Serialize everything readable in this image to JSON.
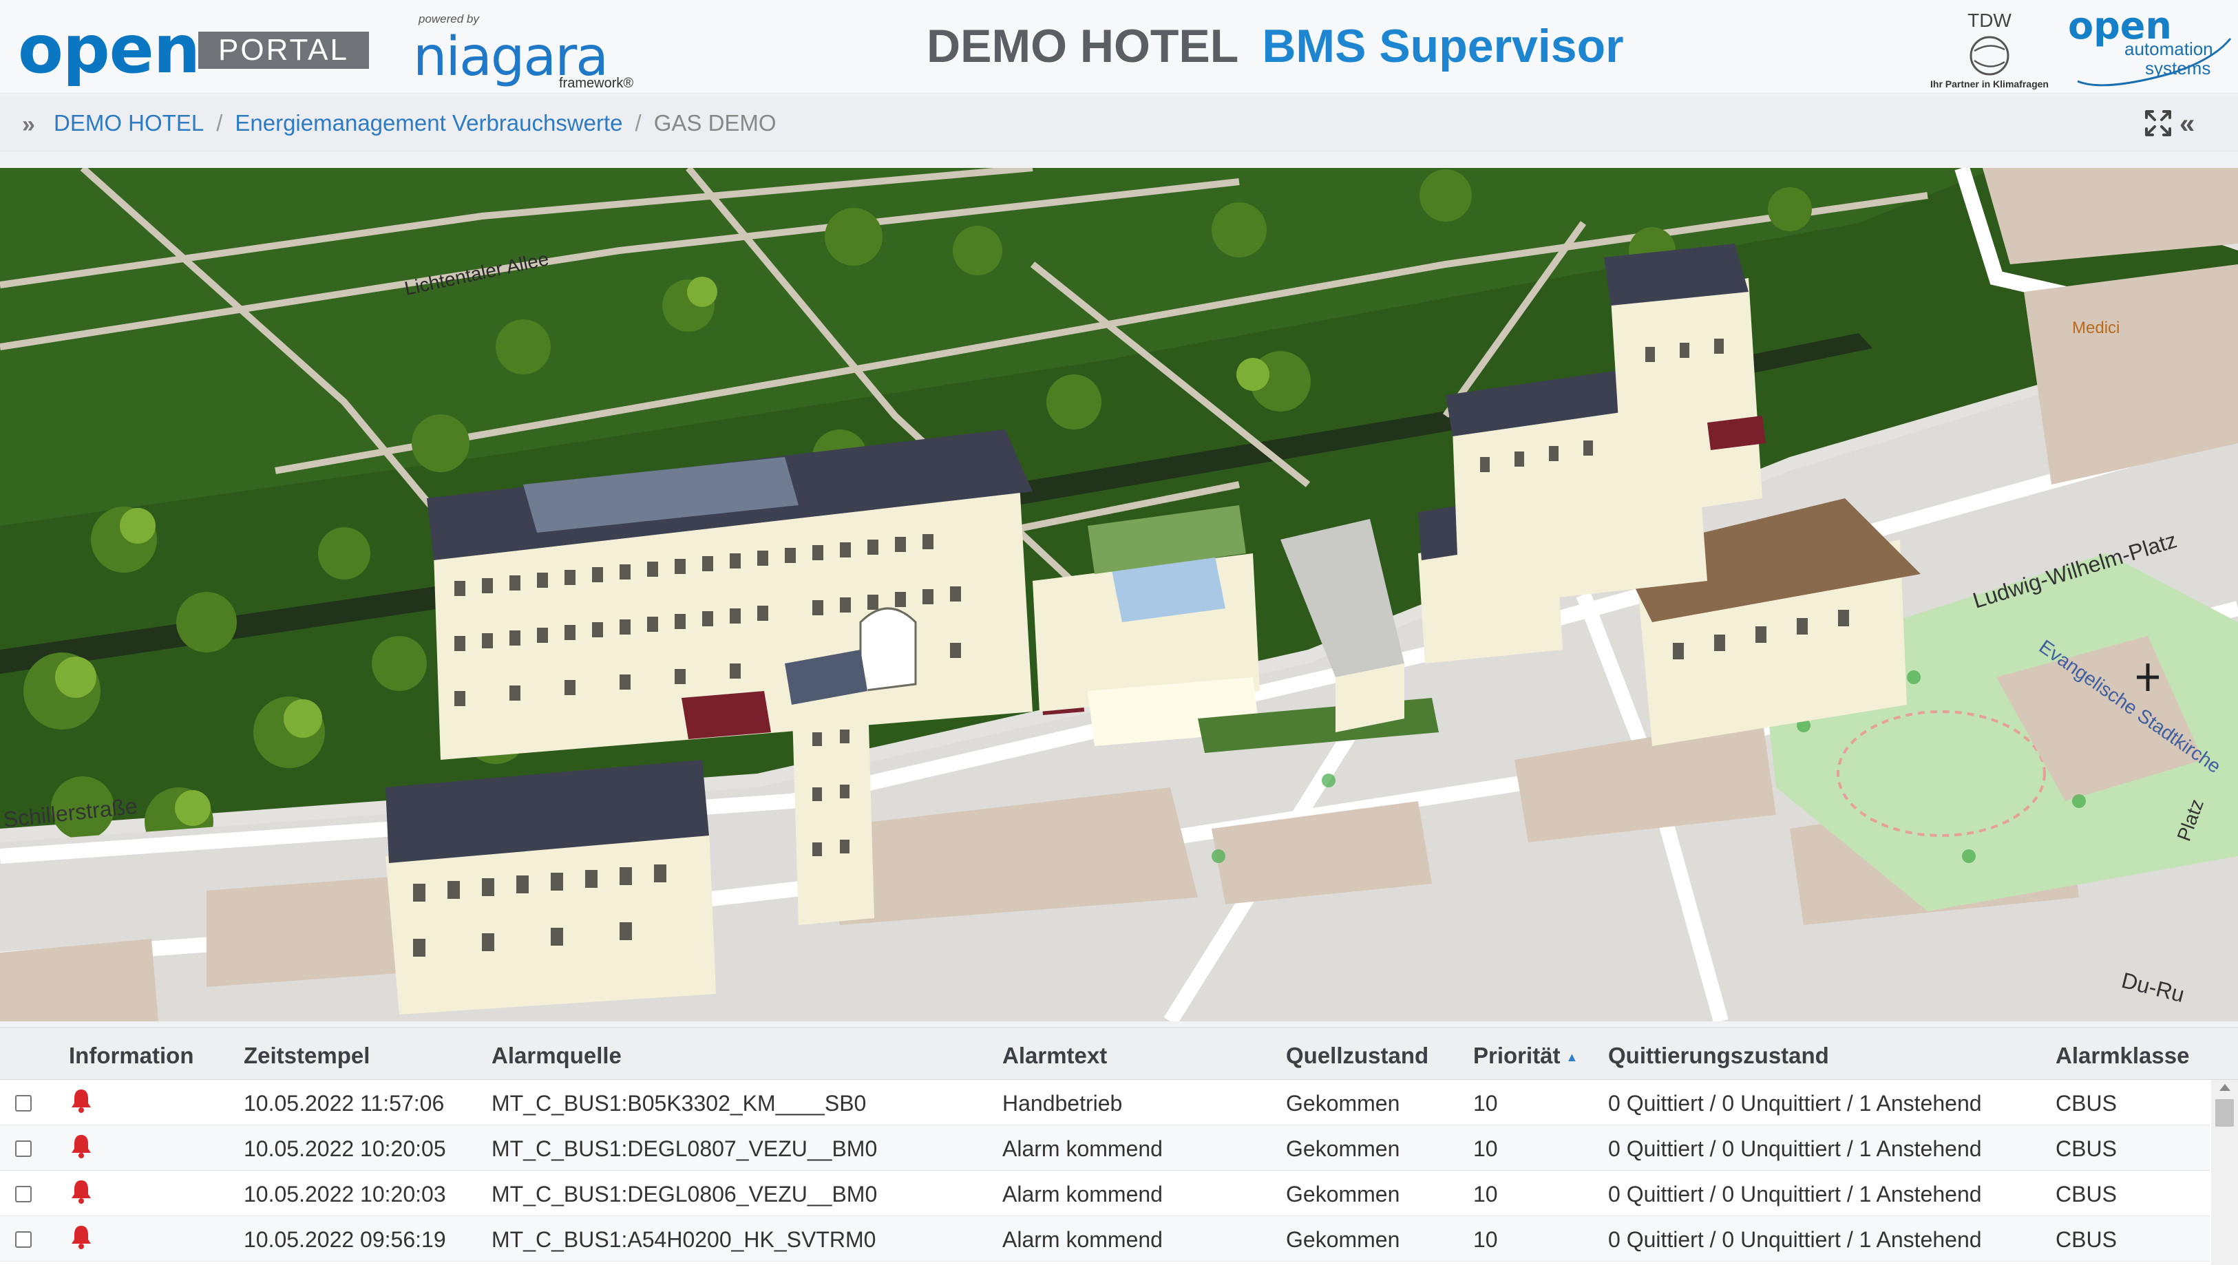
{
  "header": {
    "logo_open": "open",
    "logo_portal": "PORTAL",
    "niagara_powered": "powered by",
    "niagara_name": "niagara",
    "niagara_framework": "framework®",
    "title_hotel": "DEMO HOTEL",
    "title_bms": "BMS Supervisor",
    "tdw_name": "TDW",
    "tdw_tagline": "Ihr Partner in Klimafragen",
    "oas_open": "open",
    "oas_automation": "automation",
    "oas_systems": "systems"
  },
  "breadcrumb": {
    "items": [
      "DEMO HOTEL",
      "Energiemanagement Verbrauchswerte"
    ],
    "separator": "/",
    "current": "GAS DEMO"
  },
  "map": {
    "street_labels": [
      "Lichtentaler Allee",
      "Schillerstraße",
      "Ludwig-Wilhelm-Platz",
      "Evangelische Stadtkirche",
      "Medici",
      "Du-Ru",
      "Platz"
    ]
  },
  "alarm_table": {
    "columns": [
      "Information",
      "Zeitstempel",
      "Alarmquelle",
      "Alarmtext",
      "Quellzustand",
      "Priorität",
      "Quittierungszustand",
      "Alarmklasse"
    ],
    "sorted_column": "Priorität",
    "rows": [
      {
        "zeitstempel": "10.05.2022 11:57:06",
        "alarmquelle": "MT_C_BUS1:B05K3302_KM____SB0",
        "alarmtext": "Handbetrieb",
        "quellzustand": "Gekommen",
        "prioritaet": "10",
        "quittierung": "0 Quittiert / 0 Unquittiert / 1 Anstehend",
        "alarmklasse": "CBUS"
      },
      {
        "zeitstempel": "10.05.2022 10:20:05",
        "alarmquelle": "MT_C_BUS1:DEGL0807_VEZU__BM0",
        "alarmtext": "Alarm kommend",
        "quellzustand": "Gekommen",
        "prioritaet": "10",
        "quittierung": "0 Quittiert / 0 Unquittiert / 1 Anstehend",
        "alarmklasse": "CBUS"
      },
      {
        "zeitstempel": "10.05.2022 10:20:03",
        "alarmquelle": "MT_C_BUS1:DEGL0806_VEZU__BM0",
        "alarmtext": "Alarm kommend",
        "quellzustand": "Gekommen",
        "prioritaet": "10",
        "quittierung": "0 Quittiert / 0 Unquittiert / 1 Anstehend",
        "alarmklasse": "CBUS"
      },
      {
        "zeitstempel": "10.05.2022 09:56:19",
        "alarmquelle": "MT_C_BUS1:A54H0200_HK_SVTRM0",
        "alarmtext": "Alarm kommend",
        "quellzustand": "Gekommen",
        "prioritaet": "10",
        "quittierung": "0 Quittiert / 0 Unquittiert / 1 Anstehend",
        "alarmklasse": "CBUS"
      }
    ]
  },
  "colors": {
    "brand_blue": "#0b76c2",
    "title_blue": "#1e86d0",
    "alarm_red": "#d9262a",
    "lawn_green": "#2e5a1b",
    "building_cream": "#f4f0d8",
    "roof_slate": "#3d4050"
  },
  "icons": {
    "breadcrumb_toggle": "double-chevron-right-icon",
    "fullscreen": "expand-arrows-icon",
    "collapse": "double-chevron-left-icon",
    "alarm": "bell-icon",
    "sort": "sort-ascending-icon"
  }
}
